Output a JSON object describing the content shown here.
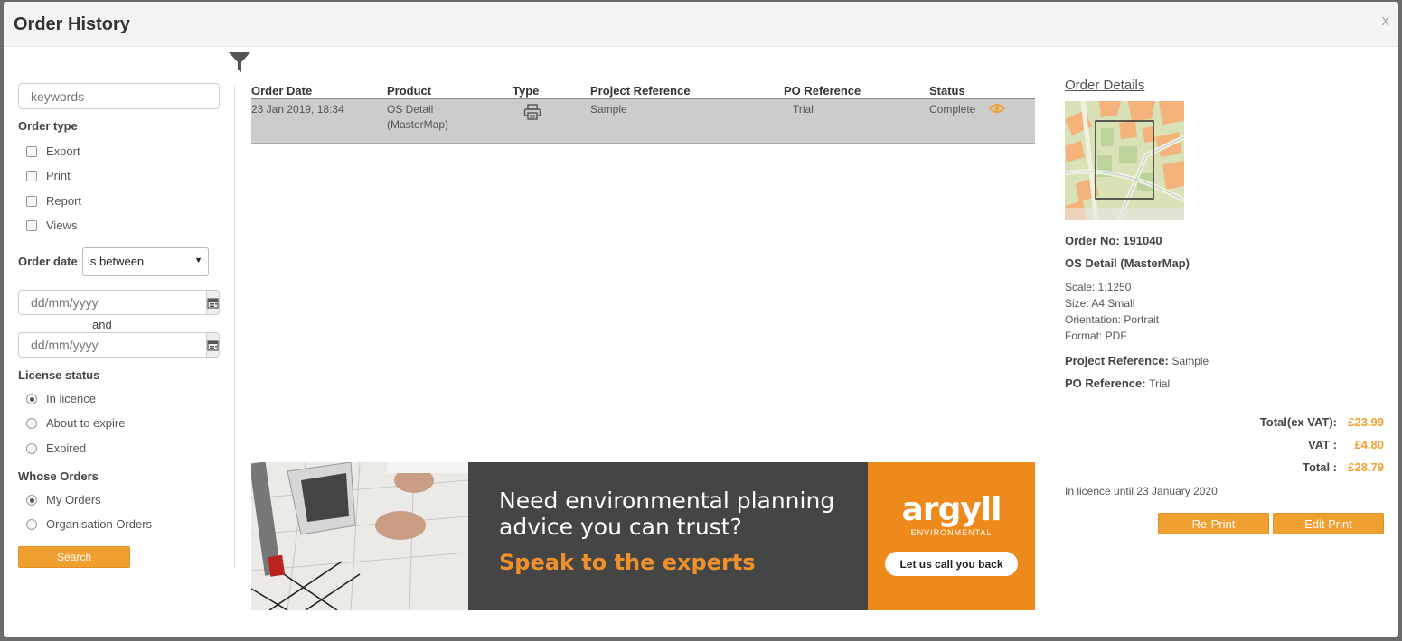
{
  "modal": {
    "title": "Order History",
    "close_label": "x"
  },
  "filters": {
    "keywords_placeholder": "keywords",
    "order_type_title": "Order type",
    "order_types": [
      {
        "label": "Export",
        "checked": false
      },
      {
        "label": "Print",
        "checked": false
      },
      {
        "label": "Report",
        "checked": false
      },
      {
        "label": "Views",
        "checked": false
      }
    ],
    "order_date_label": "Order date",
    "order_date_operator": "is between",
    "date_from_placeholder": "dd/mm/yyyy",
    "and_label": "and",
    "date_to_placeholder": "dd/mm/yyyy",
    "license_status_title": "License status",
    "license_statuses": [
      {
        "label": "In licence",
        "checked": true
      },
      {
        "label": "About to expire",
        "checked": false
      },
      {
        "label": "Expired",
        "checked": false
      }
    ],
    "whose_orders_title": "Whose Orders",
    "whose_orders": [
      {
        "label": "My Orders",
        "checked": true
      },
      {
        "label": "Organisation Orders",
        "checked": false
      }
    ],
    "search_label": "Search"
  },
  "table": {
    "headers": [
      "Order Date",
      "Product",
      "Type",
      "Project Reference",
      "PO Reference",
      "Status"
    ],
    "rows": [
      {
        "order_date": "23 Jan 2019, 18:34",
        "product_line1": "OS Detail",
        "product_line2": "(MasterMap)",
        "type_icon": "printer-icon",
        "project_reference": "Sample",
        "po_reference": "Trial",
        "status": "Complete"
      }
    ]
  },
  "banner": {
    "headline_line1": "Need environmental planning",
    "headline_line2": "advice you can trust?",
    "subheadline": "Speak to the experts",
    "logo_name": "argyll",
    "logo_sub": "ENVIRONMENTAL",
    "cta_label": "Let us call you back",
    "accent_color": "#ee8a1c",
    "dark_color": "#454545"
  },
  "details": {
    "title": "Order Details",
    "order_no_label": "Order No: 191040",
    "product": "OS Detail (MasterMap)",
    "scale": "Scale: 1:1250",
    "size": "Size: A4 Small",
    "orientation": "Orientation: Portrait",
    "format": "Format: PDF",
    "project_reference_label": "Project Reference:",
    "project_reference_value": "Sample",
    "po_reference_label": "PO Reference:",
    "po_reference_value": "Trial",
    "total_ex_vat_label": "Total(ex VAT):",
    "total_ex_vat_value": "£23.99",
    "vat_label": "VAT :",
    "vat_value": "£4.80",
    "total_label": "Total :",
    "total_value": "£28.79",
    "licence_text": "In licence until 23 January 2020",
    "reprint_label": "Re-Print",
    "edit_print_label": "Edit Print"
  },
  "colors": {
    "accent_orange": "#f0a030",
    "row_highlight": "#cccccc"
  }
}
